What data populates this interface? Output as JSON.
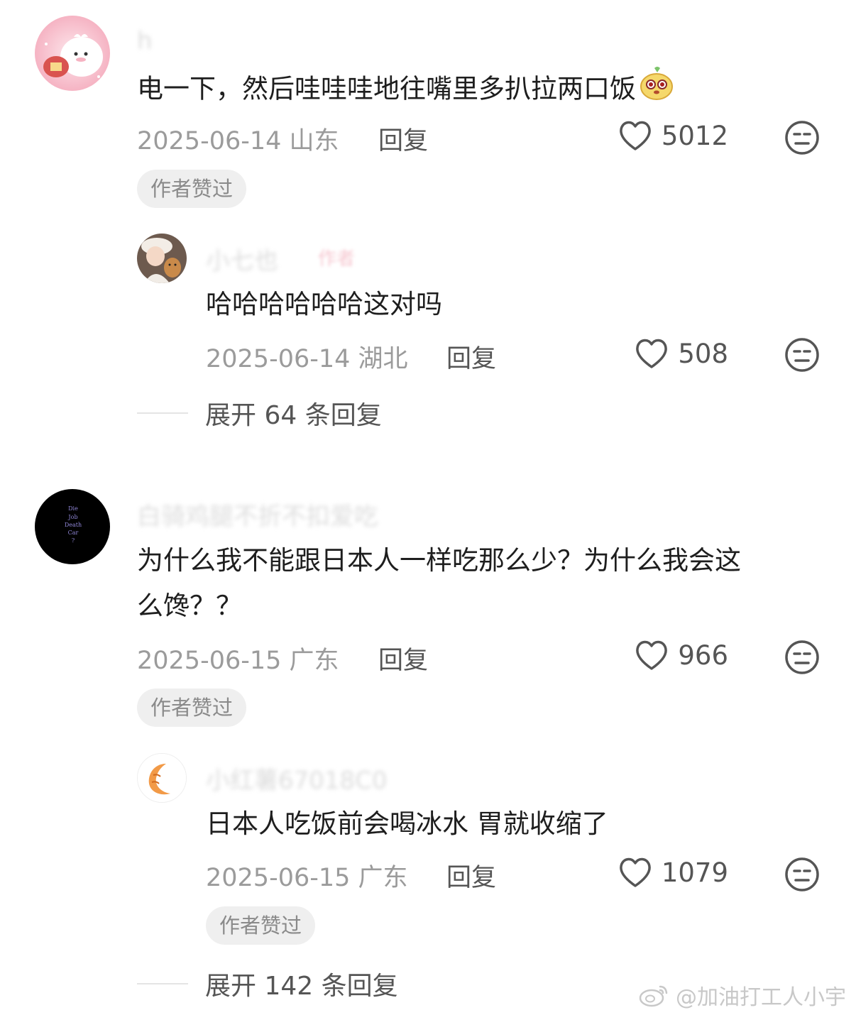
{
  "comments": [
    {
      "username": "h",
      "text": "电一下，然后哇哇哇地往嘴里多扒拉两口饭",
      "date": "2025-06-14",
      "location": "山东",
      "reply_label": "回复",
      "likes": "5012",
      "badge": "作者赞过",
      "replies": [
        {
          "username": "",
          "author_tag": "作者",
          "text": "哈哈哈哈哈哈这对吗",
          "date": "2025-06-14",
          "location": "湖北",
          "reply_label": "回复",
          "likes": "508"
        }
      ],
      "expand_label": "展开 64 条回复"
    },
    {
      "username": "",
      "avatar_text": [
        "Die",
        "Job",
        "Death",
        "Car",
        "?"
      ],
      "text_line1": "为什么我不能跟日本人一样吃那么少？为什么我会这",
      "text_line2": "么馋？？",
      "date": "2025-06-15",
      "location": "广东",
      "reply_label": "回复",
      "likes": "966",
      "badge": "作者赞过",
      "replies": [
        {
          "username": "小红薯67018C0",
          "text": "日本人吃饭前会喝冰水 胃就收缩了",
          "date": "2025-06-15",
          "location": "广东",
          "reply_label": "回复",
          "likes": "1079",
          "badge": "作者赞过"
        }
      ],
      "expand_label": "展开 142 条回复"
    }
  ],
  "watermark": "@加油打工人小宇",
  "colors": {
    "text": "#1e1e1e",
    "meta": "#9b9b9b",
    "badge_bg": "#efefef",
    "badge_text": "#8a8a8a"
  },
  "icons": [
    "heart-outline-icon",
    "neutral-face-icon",
    "weibo-logo-icon",
    "cute-emoji-icon"
  ]
}
